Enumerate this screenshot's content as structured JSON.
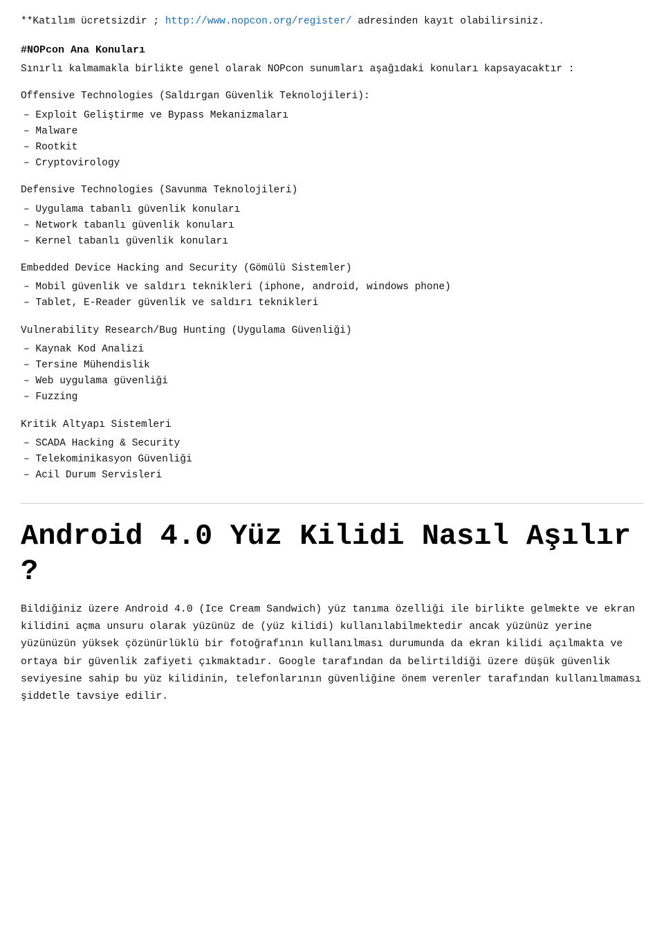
{
  "top_notice": {
    "text_before": "**Katılım ücretsizdir ; ",
    "link_text": "http://www.nopcon.org/register/",
    "link_url": "http://www.nopcon.org/register/",
    "text_after": " adresinden kayıt olabilirsiniz."
  },
  "nopcon_section": {
    "title": "#NOPcon Ana Konuları",
    "intro": "Sınırlı kalmamakla birlikte genel olarak NOPcon sunumları aşağıdaki konuları kapsayacaktır :"
  },
  "offensive": {
    "heading": "Offensive Technologies (Saldırgan Güvenlik Teknolojileri):",
    "items": [
      "– Exploit Geliştirme ve Bypass Mekanizmaları",
      "– Malware",
      "– Rootkit",
      "– Cryptovirology"
    ]
  },
  "defensive": {
    "heading": "Defensive Technologies (Savunma Teknolojileri)",
    "items": [
      "– Uygulama tabanlı güvenlik konuları",
      "– Network tabanlı güvenlik konuları",
      "– Kernel tabanlı güvenlik konuları"
    ]
  },
  "embedded": {
    "heading": "Embedded Device Hacking and Security (Gömülü Sistemler)",
    "items": [
      "– Mobil güvenlik ve saldırı teknikleri (iphone, android, windows phone)",
      "– Tablet, E-Reader güvenlik ve saldırı teknikleri"
    ]
  },
  "vulnerability": {
    "heading": "Vulnerability Research/Bug Hunting (Uygulama Güvenliği)",
    "items": [
      "– Kaynak Kod Analizi",
      "– Tersine Mühendislik",
      "– Web uygulama güvenliği",
      "– Fuzzing"
    ]
  },
  "kritik": {
    "heading": "Kritik Altyapı Sistemleri",
    "items": [
      "– SCADA Hacking & Security",
      "– Telekominikasyon Güvenliği",
      "– Acil Durum Servisleri"
    ]
  },
  "article": {
    "title": "Android 4.0 Yüz Kilidi Nasıl Aşılır ?",
    "body": "Bildiğiniz üzere Android 4.0 (Ice Cream Sandwich) yüz tanıma özelliği ile birlikte gelmekte ve ekran kilidini açma unsuru olarak yüzünüz de (yüz kilidi) kullanılabilmektedir ancak yüzünüz yerine yüzünüzün yüksek çözünürlüklü bir fotoğrafının kullanılması durumunda da ekran kilidi açılmakta ve ortaya bir güvenlik zafiyeti çıkmaktadır. Google tarafından da belirtildiği üzere düşük güvenlik seviyesine sahip bu yüz kilidinin, telefonlarının güvenliğine önem verenler tarafından kullanılmaması şiddetle tavsiye edilir."
  }
}
